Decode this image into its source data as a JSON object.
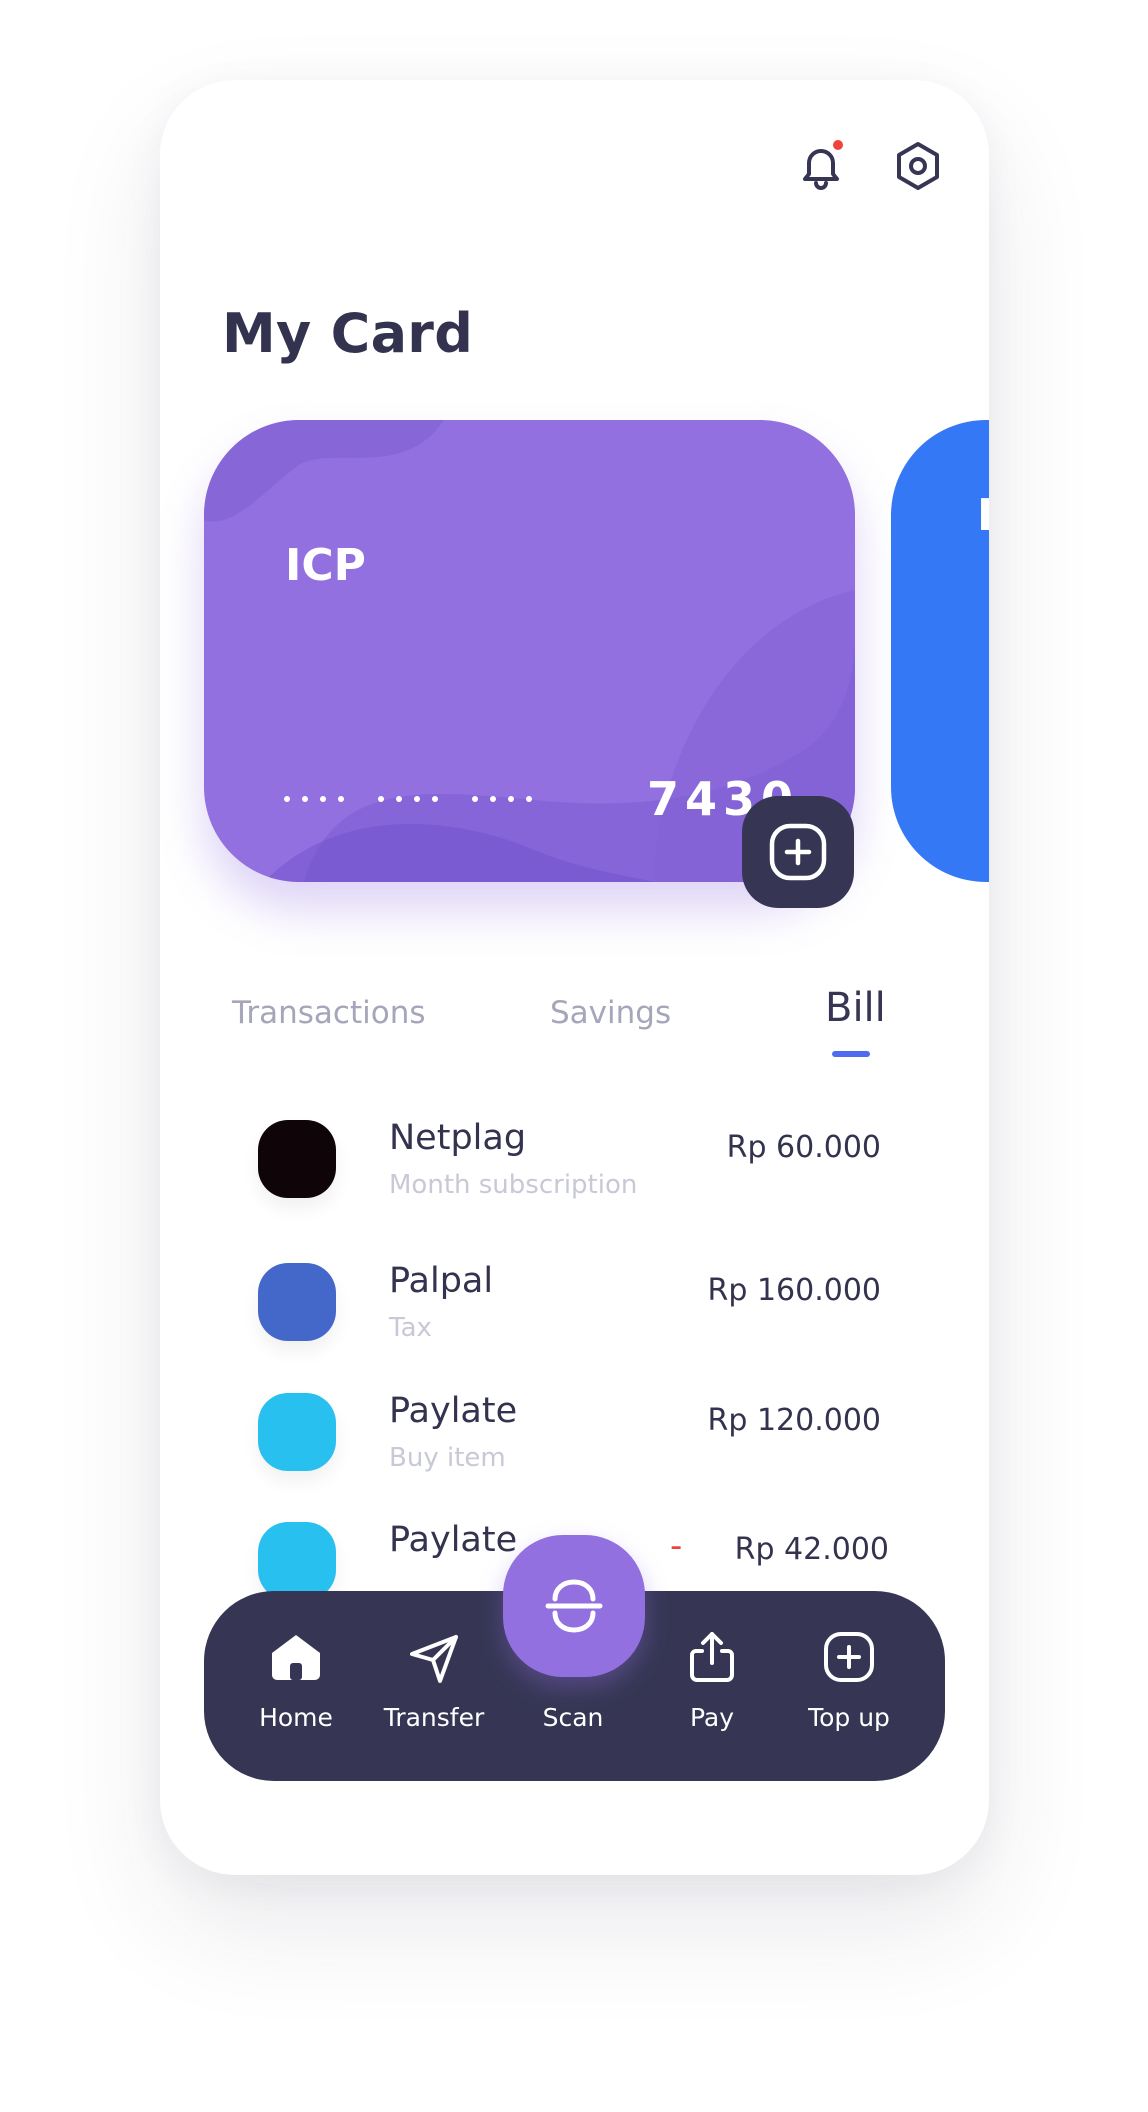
{
  "header": {
    "notification_icon": "bell-icon",
    "settings_icon": "settings-icon",
    "title": "My Card"
  },
  "cards": [
    {
      "name": "ICP",
      "masked_groups": [
        "....",
        "....",
        "...."
      ],
      "last_digits": "7430",
      "color": "#9270e0"
    },
    {
      "name": "I",
      "color": "#3478f6"
    }
  ],
  "add_card_icon": "plus-square-icon",
  "tabs": [
    {
      "label": "Transactions",
      "active": false
    },
    {
      "label": "Savings",
      "active": false
    },
    {
      "label": "Bill",
      "active": true
    }
  ],
  "bills": [
    {
      "name": "Netplag",
      "subtitle": "Month subscription",
      "amount": "Rp 60.000",
      "color": "#0f0508"
    },
    {
      "name": "Palpal",
      "subtitle": "Tax",
      "amount": "Rp 160.000",
      "color": "#4468c9"
    },
    {
      "name": "Paylate",
      "subtitle": "Buy item",
      "amount": "Rp 120.000",
      "color": "#27c0ef"
    },
    {
      "name": "Paylate",
      "subtitle": "",
      "amount": "Rp 42.000",
      "sign": "-",
      "color": "#27c0ef"
    }
  ],
  "nav": {
    "items": [
      {
        "label": "Home",
        "icon": "home-icon"
      },
      {
        "label": "Transfer",
        "icon": "send-icon"
      },
      {
        "label": "Scan",
        "icon": "scan-icon"
      },
      {
        "label": "Pay",
        "icon": "share-icon"
      },
      {
        "label": "Top up",
        "icon": "plus-square-icon"
      }
    ]
  },
  "colors": {
    "primary_purple": "#9270e0",
    "dark_navy": "#363654",
    "accent_blue": "#4f6cf0",
    "notification_red": "#f0413e"
  }
}
